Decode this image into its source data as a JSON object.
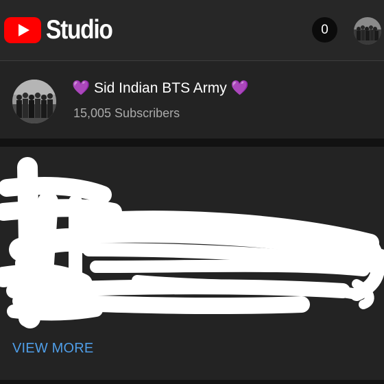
{
  "app": {
    "logo_icon": "youtube-play-icon",
    "title": "Studio",
    "notification_count": "0"
  },
  "channel": {
    "heart_emoji": "💜",
    "name": "Sid Indian BTS Army",
    "subscribers": "15,005 Subscribers"
  },
  "card": {
    "view_more_label": "VIEW MORE"
  },
  "colors": {
    "background": "#121212",
    "card": "#232323",
    "appbar": "#272727",
    "youtube_red": "#ff0000",
    "link_blue": "#4f9ee8",
    "heart_purple": "#9a3cf0",
    "secondary_text": "#aaaaaa"
  }
}
